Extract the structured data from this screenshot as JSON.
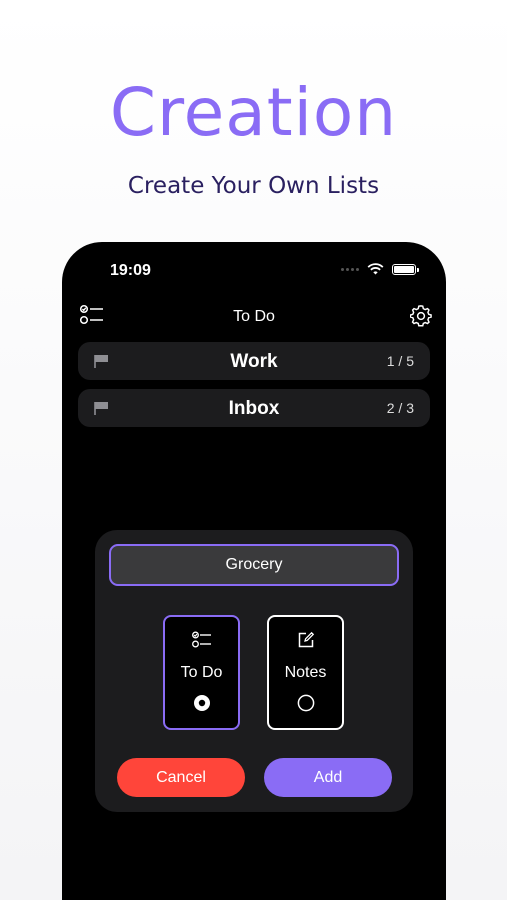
{
  "promo": {
    "headline": "Creation",
    "subheadline": "Create Your Own Lists"
  },
  "status_bar": {
    "time": "19:09"
  },
  "nav": {
    "title": "To Do",
    "left_icon": "checklist-icon",
    "right_icon": "gear-icon"
  },
  "lists": [
    {
      "name": "Work",
      "count": "1 / 5",
      "icon": "flag-icon"
    },
    {
      "name": "Inbox",
      "count": "2 / 3",
      "icon": "flag-icon"
    }
  ],
  "new_list_dialog": {
    "name_value": "Grocery",
    "types": [
      {
        "label": "To Do",
        "icon": "checklist-icon",
        "selected": true
      },
      {
        "label": "Notes",
        "icon": "edit-note-icon",
        "selected": false
      }
    ],
    "cancel_label": "Cancel",
    "add_label": "Add"
  },
  "colors": {
    "accent": "#8a6cf5",
    "danger": "#ff453a",
    "headline_sub": "#2a2060",
    "row_bg": "#1c1c1e"
  }
}
